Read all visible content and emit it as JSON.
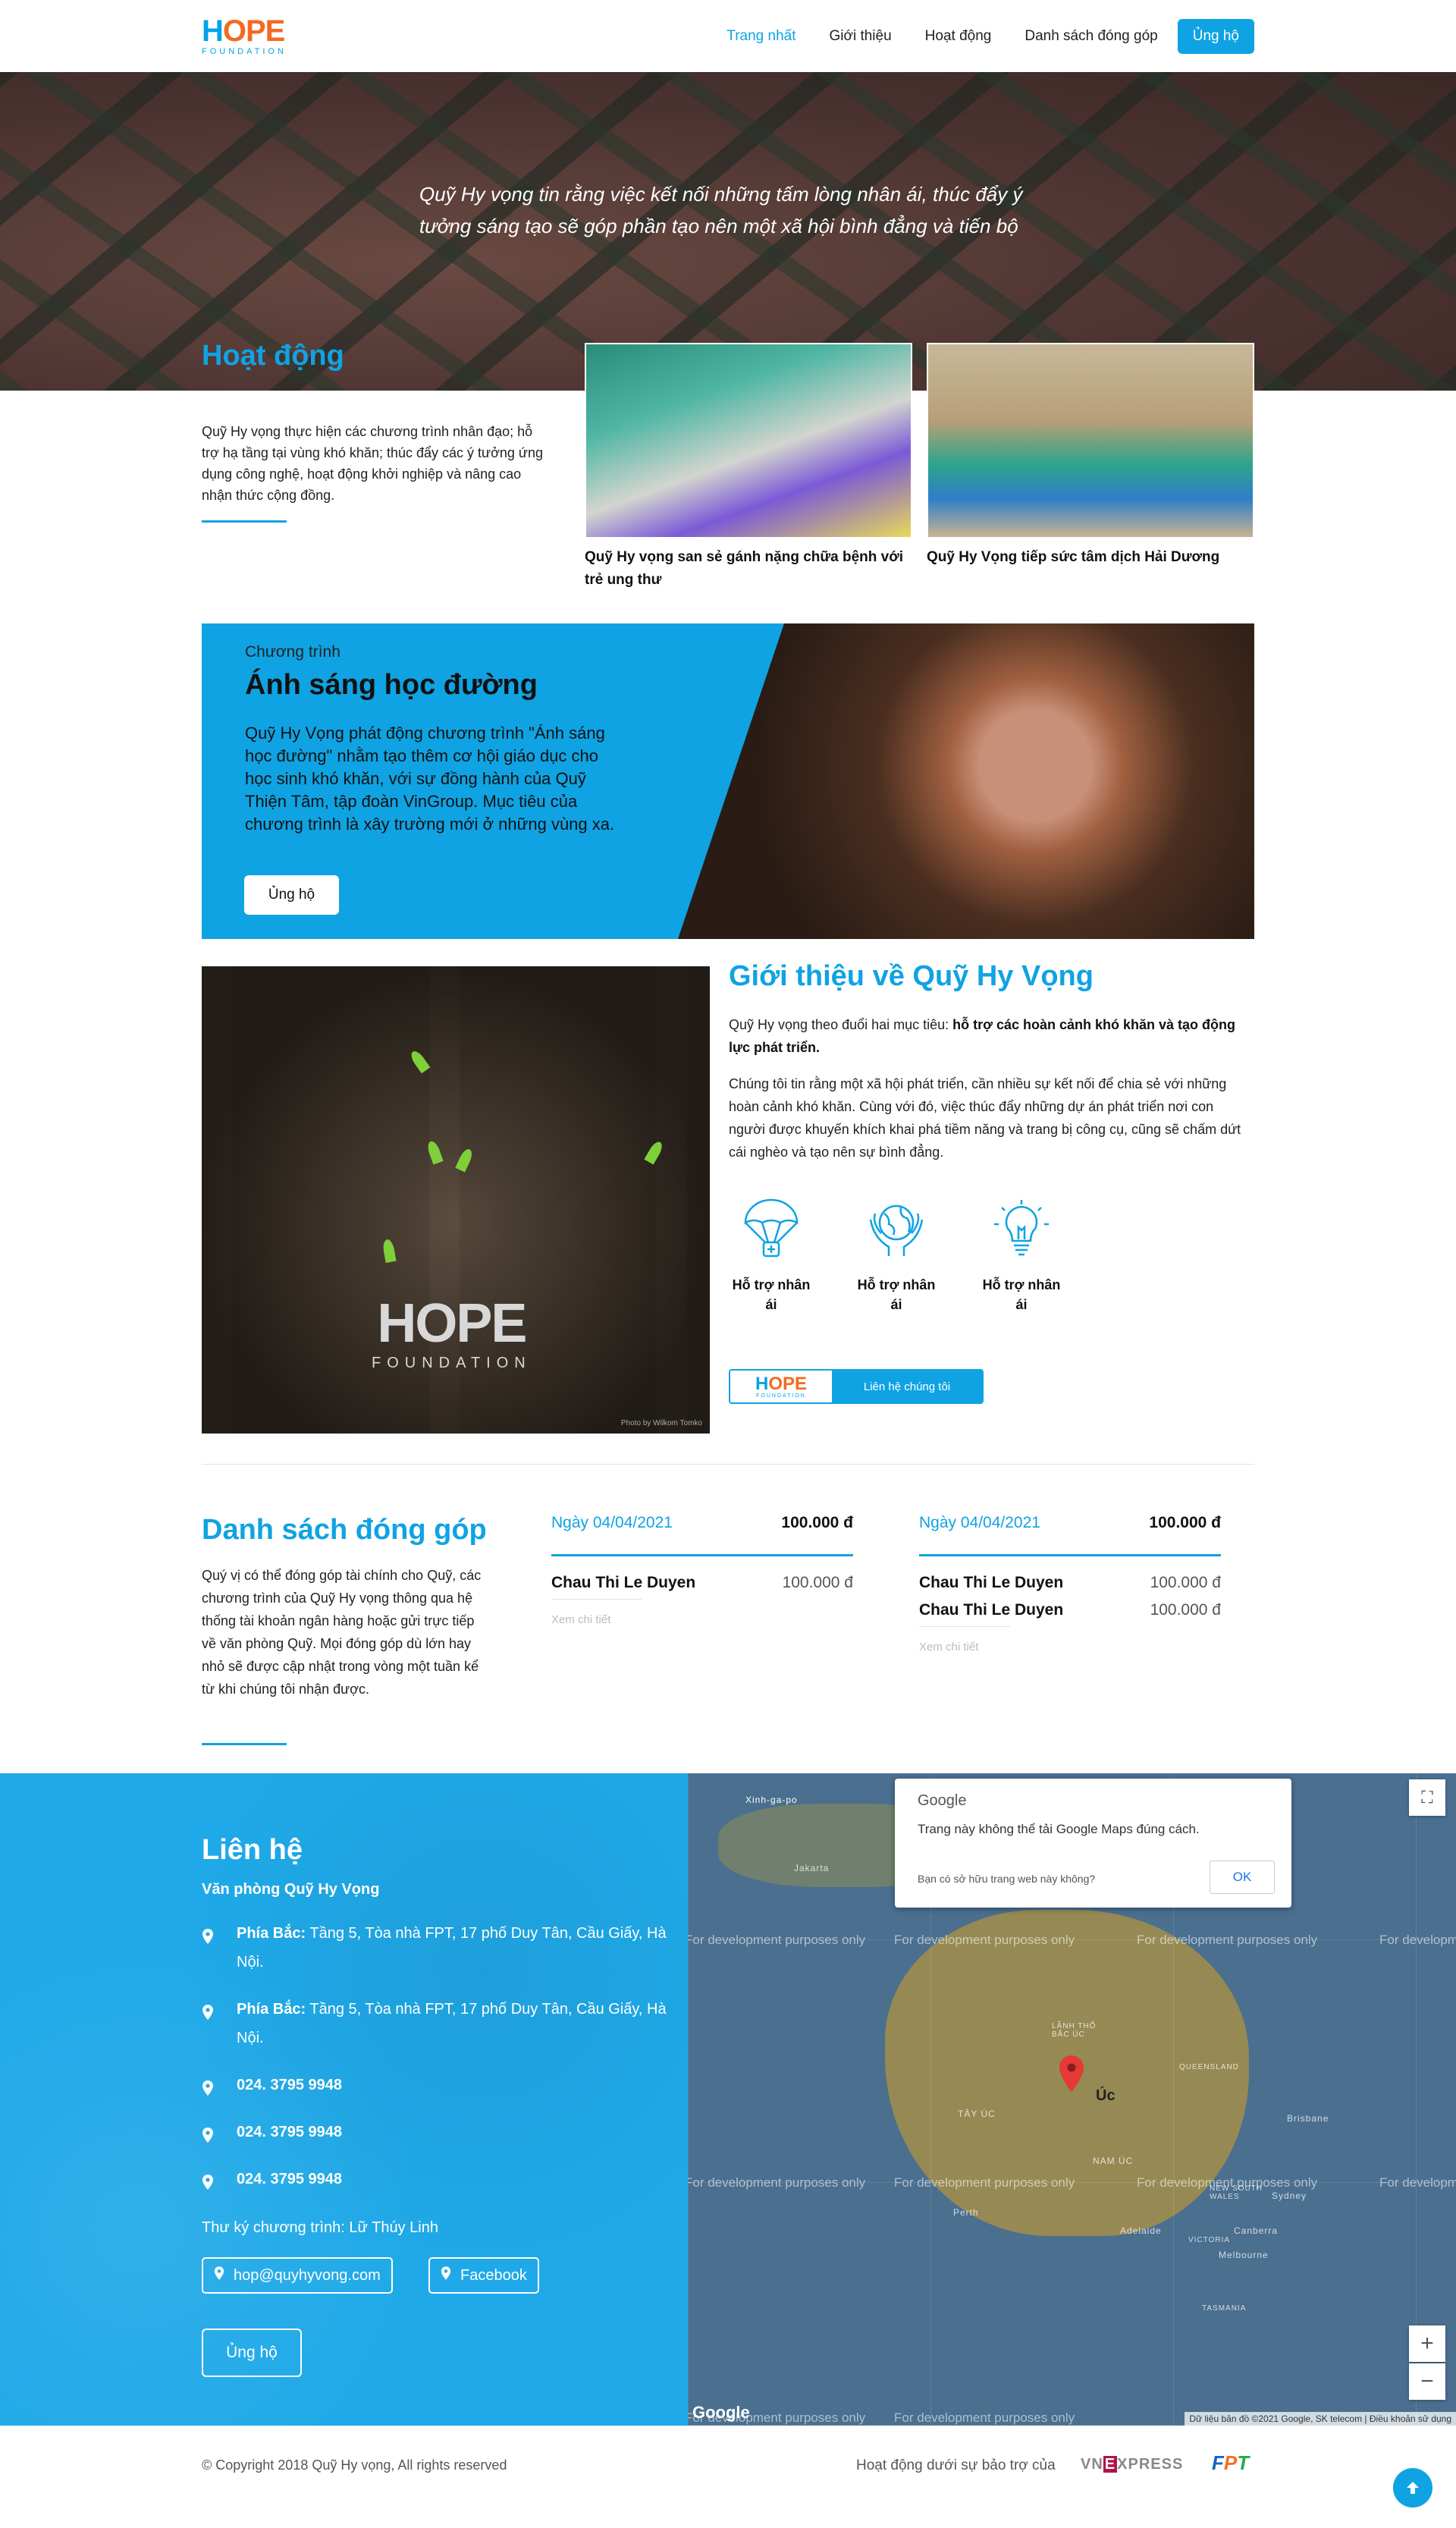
{
  "brand": {
    "logo_main_h": "H",
    "logo_main_rest": "OPE",
    "logo_sub": "FOUNDATION",
    "accent": "#0fa3e3",
    "orange": "#f26b21"
  },
  "nav": {
    "items": [
      "Trang nhất",
      "Giới thiệu",
      "Hoạt động",
      "Danh sách đóng góp"
    ],
    "active": "Trang nhất",
    "cta": "Ủng hộ"
  },
  "hero": {
    "quote": "Quỹ Hy vọng tin rằng việc kết nối những tấm lòng nhân ái, thúc đẩy ý tưởng sáng tạo sẽ góp phần tạo nên một xã hội bình đẳng và tiến bộ"
  },
  "activities": {
    "title": "Hoạt động",
    "desc": "Quỹ Hy vọng thực hiện các chương trình nhân đạo; hỗ trợ hạ tầng tại vùng khó khăn; thúc đẩy các ý tưởng ứng dụng công nghệ, hoạt động khởi nghiệp và nâng cao nhận thức cộng đồng.",
    "cards": [
      {
        "caption": "Quỹ Hy vọng san sẻ gánh nặng chữa bệnh với trẻ ung thư"
      },
      {
        "caption": "Quỹ Hy Vọng tiếp sức tâm dịch Hải Dương"
      }
    ]
  },
  "program": {
    "label": "Chương trình",
    "title": "Ánh sáng học đường",
    "desc": "Quỹ Hy Vọng phát động chương trình \"Ánh sáng học đường\" nhằm tạo thêm cơ hội giáo dục cho học sinh khó khăn, với sự đồng hành của Quỹ Thiện Tâm, tập đoàn VinGroup. Mục tiêu của chương trình là xây trường mới ở những vùng xa.",
    "button": "Ủng hộ"
  },
  "about": {
    "title": "Giới thiệu về Quỹ Hy Vọng",
    "p1_prefix": "Quỹ Hy vọng theo đuổi hai mục tiêu: ",
    "p1_bold": "hỗ trợ các hoàn cảnh khó khăn và tạo động lực phát triển.",
    "p2": "Chúng tôi tin rằng một xã hội phát triển, cần nhiều sự kết nối để chia sẻ với những hoàn cảnh khó khăn. Cùng với đó, việc thúc đẩy những dự án phát triển nơi con người được khuyến khích khai phá tiềm năng và trang bị công cụ, cũng sẽ chấm dứt cái nghèo và tạo nên sự bình đẳng.",
    "image_logo_main": "HOPE",
    "image_logo_sub": "FOUNDATION",
    "photo_credit": "Photo by Wilkom Tomko",
    "features": [
      {
        "icon": "parachute-icon",
        "label": "Hỗ trợ nhân ái"
      },
      {
        "icon": "globe-hands-icon",
        "label": "Hỗ trợ nhân ái"
      },
      {
        "icon": "lightbulb-icon",
        "label": "Hỗ trợ nhân ái"
      }
    ],
    "cta_logo_h": "H",
    "cta_logo_rest": "OPE",
    "cta_logo_sub": "FOUNDATION",
    "cta": "Liên hệ chúng tôi"
  },
  "donations": {
    "title": "Danh sách đóng góp",
    "desc": "Quý vị có thể đóng góp tài chính cho Quỹ, các chương trình của Quỹ Hy vọng thông qua hệ thống tài khoản ngân hàng hoặc gửi trực tiếp về văn phòng Quỹ. Mọi đóng góp dù lớn hay nhỏ sẽ được cập nhật trong vòng một tuần kể từ khi chúng tôi nhận được.",
    "columns": [
      {
        "date": "Ngày 04/04/2021",
        "total": "100.000 đ",
        "rows": [
          {
            "name": "Chau Thi Le Duyen",
            "amount": "100.000 đ"
          }
        ],
        "more": "Xem chi tiết"
      },
      {
        "date": "Ngày 04/04/2021",
        "total": "100.000 đ",
        "rows": [
          {
            "name": "Chau Thi Le Duyen",
            "amount": "100.000 đ"
          },
          {
            "name": "Chau Thi Le Duyen",
            "amount": "100.000 đ"
          }
        ],
        "more": "Xem chi tiết"
      }
    ]
  },
  "contact": {
    "title": "Liên hệ",
    "office": "Văn phòng Quỹ Hy Vọng",
    "addresses": [
      {
        "label": "Phía Bắc:",
        "text": " Tầng 5, Tòa nhà FPT, 17 phố Duy Tân, Cầu Giấy, Hà Nội."
      },
      {
        "label": "Phía Bắc:",
        "text": " Tầng 5, Tòa nhà FPT, 17 phố Duy Tân, Cầu Giấy, Hà Nội."
      }
    ],
    "phones": [
      "024. 3795 9948",
      "024. 3795 9948",
      "024. 3795 9948"
    ],
    "secretary": "Thư ký chương trình: Lữ Thúy Linh",
    "email": "hop@quyhyvong.com",
    "facebook": "Facebook",
    "button": "Ủng hộ"
  },
  "map": {
    "dialog_brand": "Google",
    "dialog_msg": "Trang này không thể tải Google Maps đúng cách.",
    "dialog_q": "Bạn có sở hữu trang web này không?",
    "dialog_ok": "OK",
    "watermark": "For development purposes only",
    "labels": {
      "singapore": "Xinh-ga-po",
      "jakarta": "Jakarta",
      "australia": "Úc",
      "north": "LÃNH THỔ BẮC ÚC",
      "queensland": "QUEENSLAND",
      "west": "TÂY ÚC",
      "south": "NAM ÚC",
      "nsw": "NEW SOUTH WALES",
      "victoria": "VICTORIA",
      "tasmania": "TASMANIA",
      "brisbane": "Brisbane",
      "sydney": "Sydney",
      "melbourne": "Melbourne",
      "perth": "Perth",
      "adelaide": "Adelaide",
      "canberra": "Canberra"
    },
    "footer": "Dữ liệu bản đồ ©2021 Google, SK telecom | Điều khoản sử dụng",
    "google_logo": "Google",
    "zoom_in": "+",
    "zoom_out": "−"
  },
  "footer": {
    "copyright": "© Copyright 2018 Quỹ Hy vọng, All rights reserved",
    "sponsor_text": "Hoạt động dưới sự bảo trợ của",
    "vne_a": "VN",
    "vne_e": "E",
    "vne_b": "XPRESS",
    "fpt_f": "F",
    "fpt_p": "P",
    "fpt_t": "T"
  }
}
